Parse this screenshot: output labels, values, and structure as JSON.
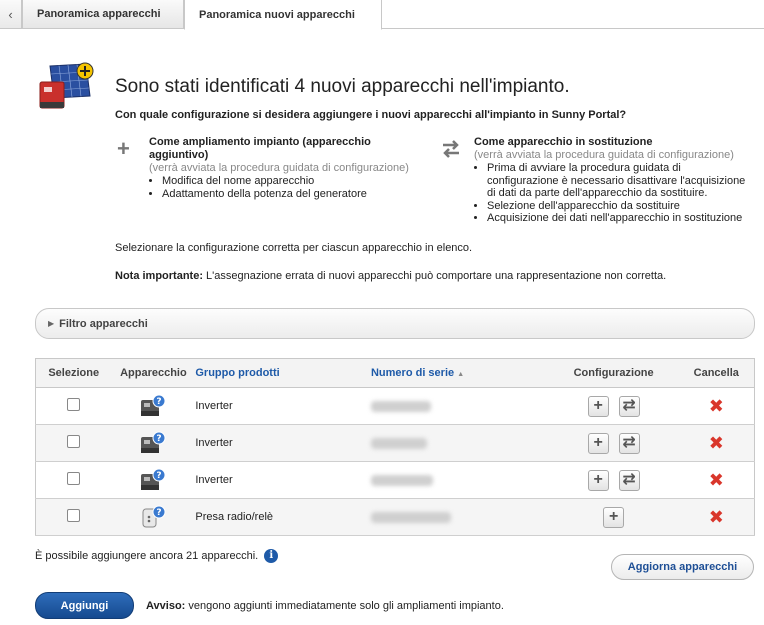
{
  "tabs": {
    "back_icon": "chevron-left-icon",
    "inactive_label": "Panoramica apparecchi",
    "active_label": "Panoramica nuovi apparecchi"
  },
  "header": {
    "title": "Sono stati identificati 4 nuovi apparecchi nell'impianto.",
    "subtitle": "Con quale configurazione si desidera aggiungere i nuovi apparecchi all'impianto in Sunny Portal?"
  },
  "option_extend": {
    "icon": "plus-icon",
    "title": "Come ampliamento impianto (apparecchio aggiuntivo)",
    "sub": "(verrà avviata la procedura guidata di configurazione)",
    "items": [
      "Modifica del nome apparecchio",
      "Adattamento della potenza del generatore"
    ]
  },
  "option_replace": {
    "icon": "swap-arrows-icon",
    "title": "Come apparecchio in sostituzione",
    "sub": "(verrà avviata la procedura guidata di configurazione)",
    "items": [
      "Prima di avviare la procedura guidata di configurazione è necessario disattivare l'acquisizione di dati da parte dell'apparecchio da sostituire.",
      "Selezione dell'apparecchio da sostituire",
      "Acquisizione dei dati nell'apparecchio in sostituzione"
    ]
  },
  "instructions": {
    "select_text": "Selezionare la configurazione corretta per ciascun apparecchio in elenco.",
    "note_label": "Nota importante:",
    "note_text": " L'assegnazione errata di nuovi apparecchi può comportare una rappresentazione non corretta."
  },
  "filter": {
    "label": "Filtro apparecchi"
  },
  "table": {
    "headers": {
      "selection": "Selezione",
      "device": "Apparecchio",
      "group": "Gruppo prodotti",
      "serial": "Numero di serie",
      "config": "Configurazione",
      "delete": "Cancella"
    },
    "sort_indicator": "▲",
    "rows": [
      {
        "group": "Inverter",
        "device_icon": "inverter-unknown-icon",
        "can_replace": true
      },
      {
        "group": "Inverter",
        "device_icon": "inverter-unknown-icon",
        "can_replace": true
      },
      {
        "group": "Inverter",
        "device_icon": "inverter-unknown-icon",
        "can_replace": true
      },
      {
        "group": "Presa radio/relè",
        "device_icon": "radio-socket-unknown-icon",
        "can_replace": false
      }
    ]
  },
  "footer": {
    "more_text": "È possibile aggiungere ancora 21 apparecchi.",
    "info_glyph": "i",
    "refresh_label": "Aggiorna apparecchi",
    "add_label": "Aggiungi",
    "notice_label": "Avviso:",
    "notice_text": " vengono aggiunti immediatamente solo gli ampliamenti impianto."
  },
  "colors": {
    "accent": "#1e5aa8",
    "delete": "#d9362b",
    "primary_button": "#1e4f96"
  }
}
